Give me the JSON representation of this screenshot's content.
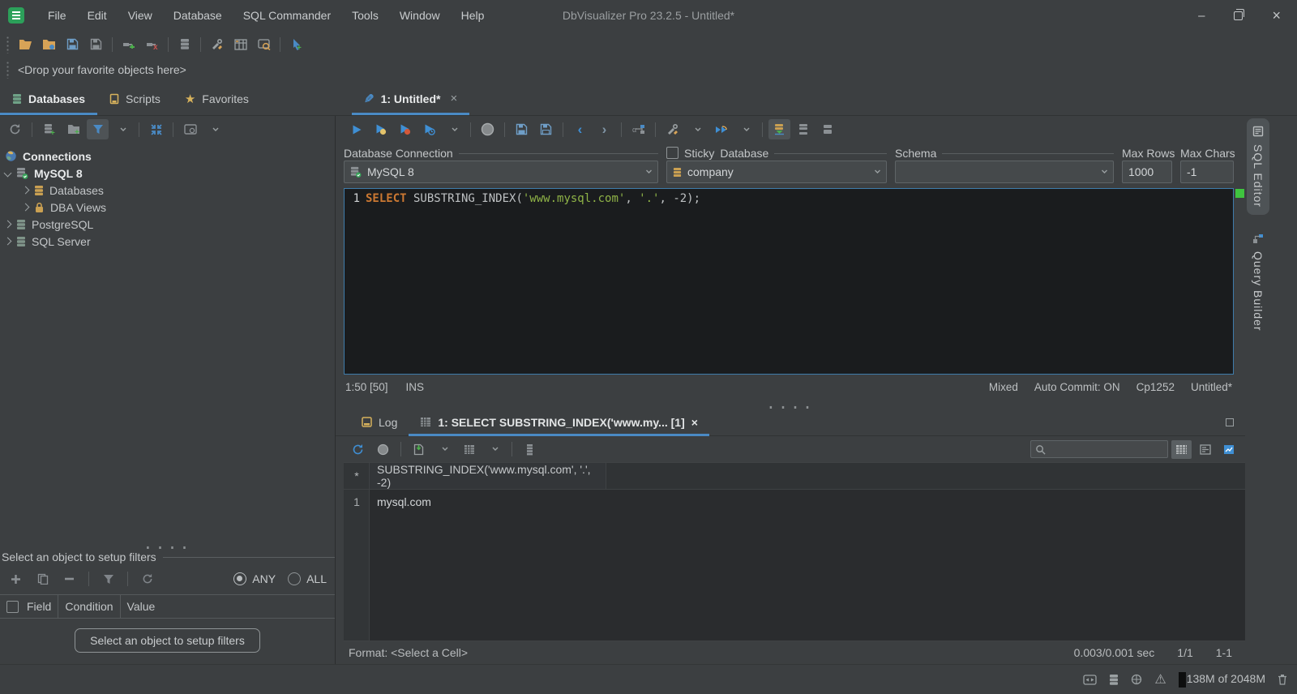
{
  "window": {
    "app_title": "DbVisualizer Pro 23.2.5 - Untitled*",
    "menu": [
      "File",
      "Edit",
      "View",
      "Database",
      "SQL Commander",
      "Tools",
      "Window",
      "Help"
    ]
  },
  "favorites_bar": {
    "text": "<Drop your favorite objects here>"
  },
  "left_panel": {
    "tabs": {
      "databases": "Databases",
      "scripts": "Scripts",
      "favorites": "Favorites"
    },
    "tree": [
      {
        "label": "Connections"
      },
      {
        "label": "MySQL 8"
      },
      {
        "label": "Databases"
      },
      {
        "label": "DBA Views"
      },
      {
        "label": "PostgreSQL"
      },
      {
        "label": "SQL Server"
      }
    ],
    "filter": {
      "header": "Select an object to setup filters",
      "any": "ANY",
      "all": "ALL",
      "columns": {
        "field": "Field",
        "condition": "Condition",
        "value": "Value"
      },
      "button": "Select an object to setup filters"
    }
  },
  "sql_editor": {
    "tab": "1: Untitled*",
    "groups": {
      "connection": {
        "label": "Database Connection",
        "value": "MySQL 8"
      },
      "sticky": "Sticky",
      "database": {
        "label": "Database",
        "value": "company"
      },
      "schema": {
        "label": "Schema",
        "value": ""
      },
      "max_rows": {
        "label": "Max Rows",
        "value": "1000"
      },
      "max_chars": {
        "label": "Max Chars",
        "value": "-1"
      }
    },
    "code": {
      "line_no": "1",
      "kw": "SELECT",
      "fn": " SUBSTRING_INDEX(",
      "s1": "'www.mysql.com'",
      "c1": ", ",
      "s2": "'.'",
      "c2": ", -2);"
    },
    "status": {
      "caret": "1:50 [50]",
      "mode": "INS",
      "dirty": "Mixed",
      "autocommit": "Auto Commit: ON",
      "encoding": "Cp1252",
      "file": "Untitled*"
    }
  },
  "results_panel": {
    "tabs": {
      "log": "Log",
      "result": "1: SELECT SUBSTRING_INDEX('www.my... [1]"
    },
    "grid": {
      "corner": "*",
      "column": "SUBSTRING_INDEX('www.mysql.com', '.', -2)",
      "row_num": "1",
      "row_value": "mysql.com"
    },
    "footer": {
      "format": "Format: <Select a Cell>",
      "time": "0.003/0.001 sec",
      "resultset": "1/1",
      "cell": "1-1"
    }
  },
  "side_tabs": {
    "sql_editor": "SQL Editor",
    "query_builder": "Query Builder"
  },
  "status_bar": {
    "memory": "138M of 2048M"
  },
  "colors": {
    "accent_blue": "#4a8ac4",
    "keyword_orange": "#cb7832",
    "string_green": "#8fb347",
    "db_yellow": "#caa052",
    "ok_green": "#3fc43f"
  }
}
